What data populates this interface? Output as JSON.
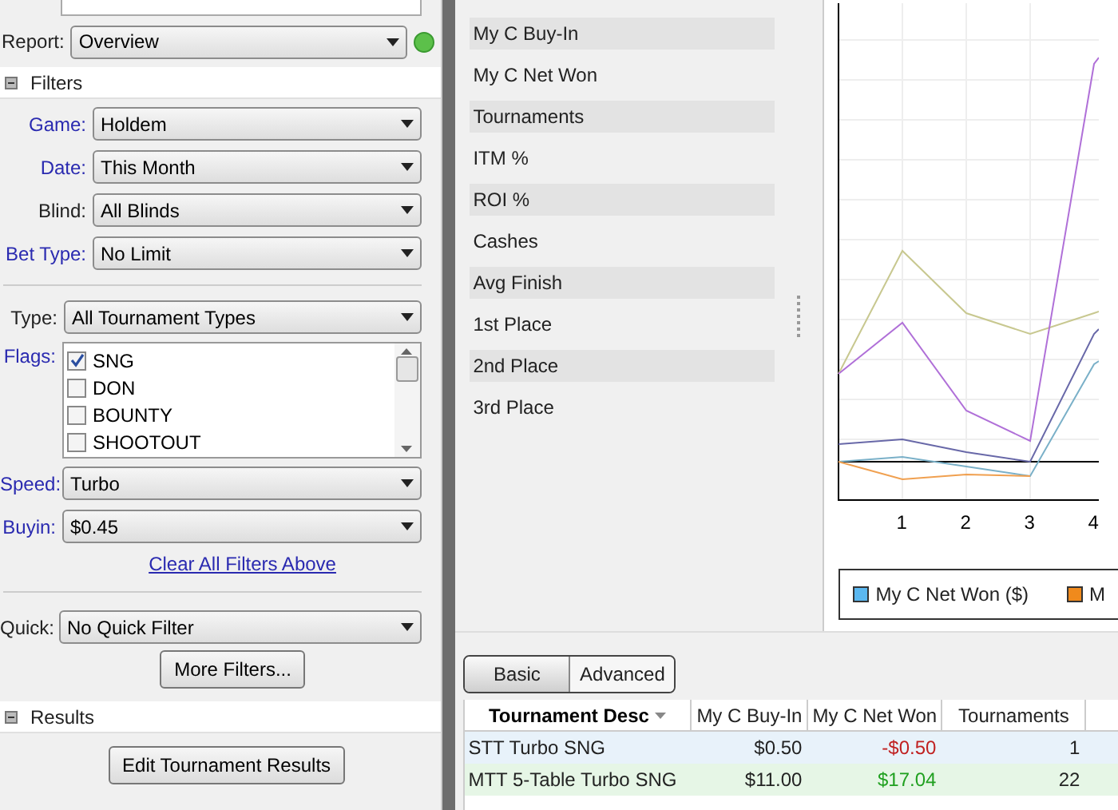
{
  "report": {
    "label": "Report:",
    "value": "Overview"
  },
  "filters": {
    "title": "Filters",
    "expanded": true,
    "rows": [
      {
        "label": "Game:",
        "value": "Holdem",
        "active": true
      },
      {
        "label": "Date:",
        "value": "This Month",
        "active": true
      },
      {
        "label": "Blind:",
        "value": "All Blinds",
        "active": false
      },
      {
        "label": "Bet Type:",
        "value": "No Limit",
        "active": true
      }
    ],
    "type": {
      "label": "Type:",
      "value": "All Tournament Types",
      "active": false
    },
    "flags": {
      "label": "Flags:",
      "active": true,
      "items": [
        {
          "label": "SNG",
          "checked": true
        },
        {
          "label": "DON",
          "checked": false
        },
        {
          "label": "BOUNTY",
          "checked": false
        },
        {
          "label": "SHOOTOUT",
          "checked": false
        }
      ]
    },
    "rows2": [
      {
        "label": "Speed:",
        "value": "Turbo",
        "active": true
      },
      {
        "label": "Buyin:",
        "value": "$0.45",
        "active": true
      }
    ],
    "clear_link": "Clear All Filters Above",
    "quick": {
      "label": "Quick:",
      "value": "No Quick Filter",
      "active": false
    },
    "more_button": "More Filters..."
  },
  "results": {
    "title": "Results",
    "expanded": true,
    "button": "Edit Tournament Results"
  },
  "stats": [
    "My C Buy-In",
    "My C Net Won",
    "Tournaments",
    "ITM %",
    "ROI %",
    "Cashes",
    "Avg Finish",
    "1st Place",
    "2nd Place",
    "3rd Place"
  ],
  "chart": {
    "xticks": [
      "1",
      "2",
      "3",
      "4"
    ],
    "legend": [
      {
        "label": "My C Net Won ($)",
        "color": "#5bb8f0"
      },
      {
        "label": "M",
        "color": "#f08a1c"
      }
    ]
  },
  "tabs": [
    {
      "label": "Basic",
      "selected": true
    },
    {
      "label": "Advanced",
      "selected": false
    }
  ],
  "table": {
    "columns": [
      "Tournament Desc",
      "My C Buy-In",
      "My C Net Won",
      "Tournaments"
    ],
    "rows": [
      {
        "desc": "STT Turbo SNG",
        "buyin": "$0.50",
        "net": "-$0.50",
        "kind": "loss",
        "count": "1",
        "color": "#e8f2fa"
      },
      {
        "desc": "MTT 5-Table Turbo SNG",
        "buyin": "$11.00",
        "net": "$17.04",
        "kind": "gain",
        "count": "22",
        "color": "#e6f6e6"
      }
    ]
  }
}
